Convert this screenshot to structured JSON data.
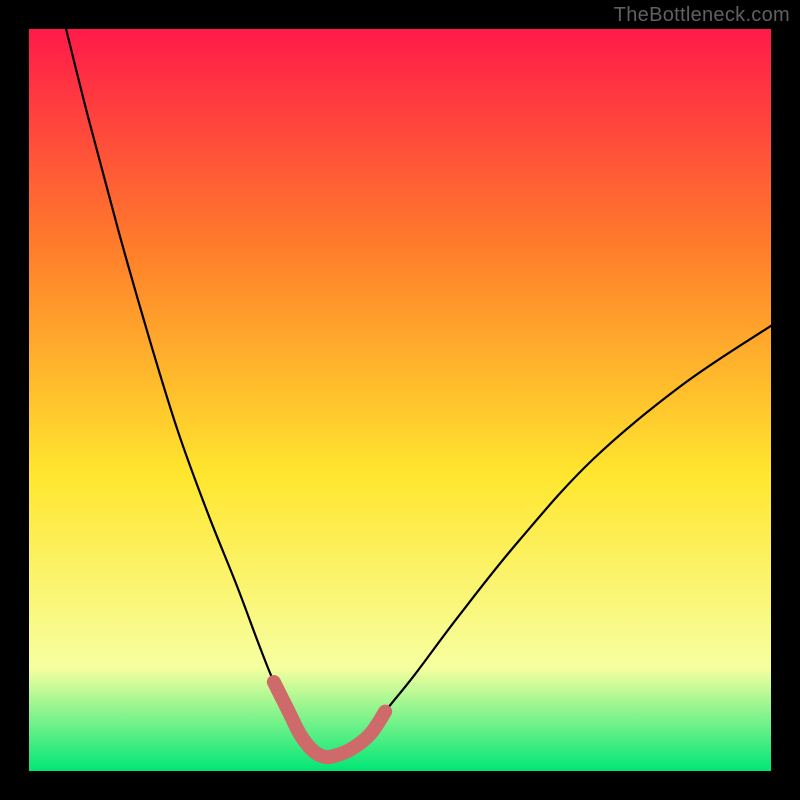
{
  "watermark": "TheBottleneck.com",
  "chart_data": {
    "type": "line",
    "title": "",
    "xlabel": "",
    "ylabel": "",
    "xlim": [
      0,
      100
    ],
    "ylim": [
      0,
      100
    ],
    "grid": false,
    "background_gradient": {
      "top": "#ff1a4a",
      "mid_upper": "#ff7f2a",
      "mid": "#ffe62e",
      "lower": "#f7ffa0",
      "bottom": "#00e676"
    },
    "series": [
      {
        "name": "bottleneck-curve",
        "color": "#000000",
        "x": [
          5,
          8,
          12,
          16,
          20,
          24,
          28,
          31,
          33,
          35,
          36.5,
          38,
          39.5,
          41,
          43.5,
          46,
          48,
          52,
          58,
          66,
          76,
          88,
          100
        ],
        "y": [
          100,
          88,
          73,
          59,
          46,
          35,
          25,
          17,
          12,
          8,
          5,
          3,
          2,
          2,
          3,
          5,
          8,
          13,
          21,
          31,
          42,
          52,
          60
        ]
      },
      {
        "name": "optimal-zone",
        "color": "#cf6a6a",
        "thick": true,
        "x": [
          33,
          35,
          36.5,
          38,
          39.5,
          41,
          43.5,
          46,
          48
        ],
        "y": [
          12,
          8,
          5,
          3,
          2,
          2,
          3,
          5,
          8
        ]
      }
    ]
  }
}
